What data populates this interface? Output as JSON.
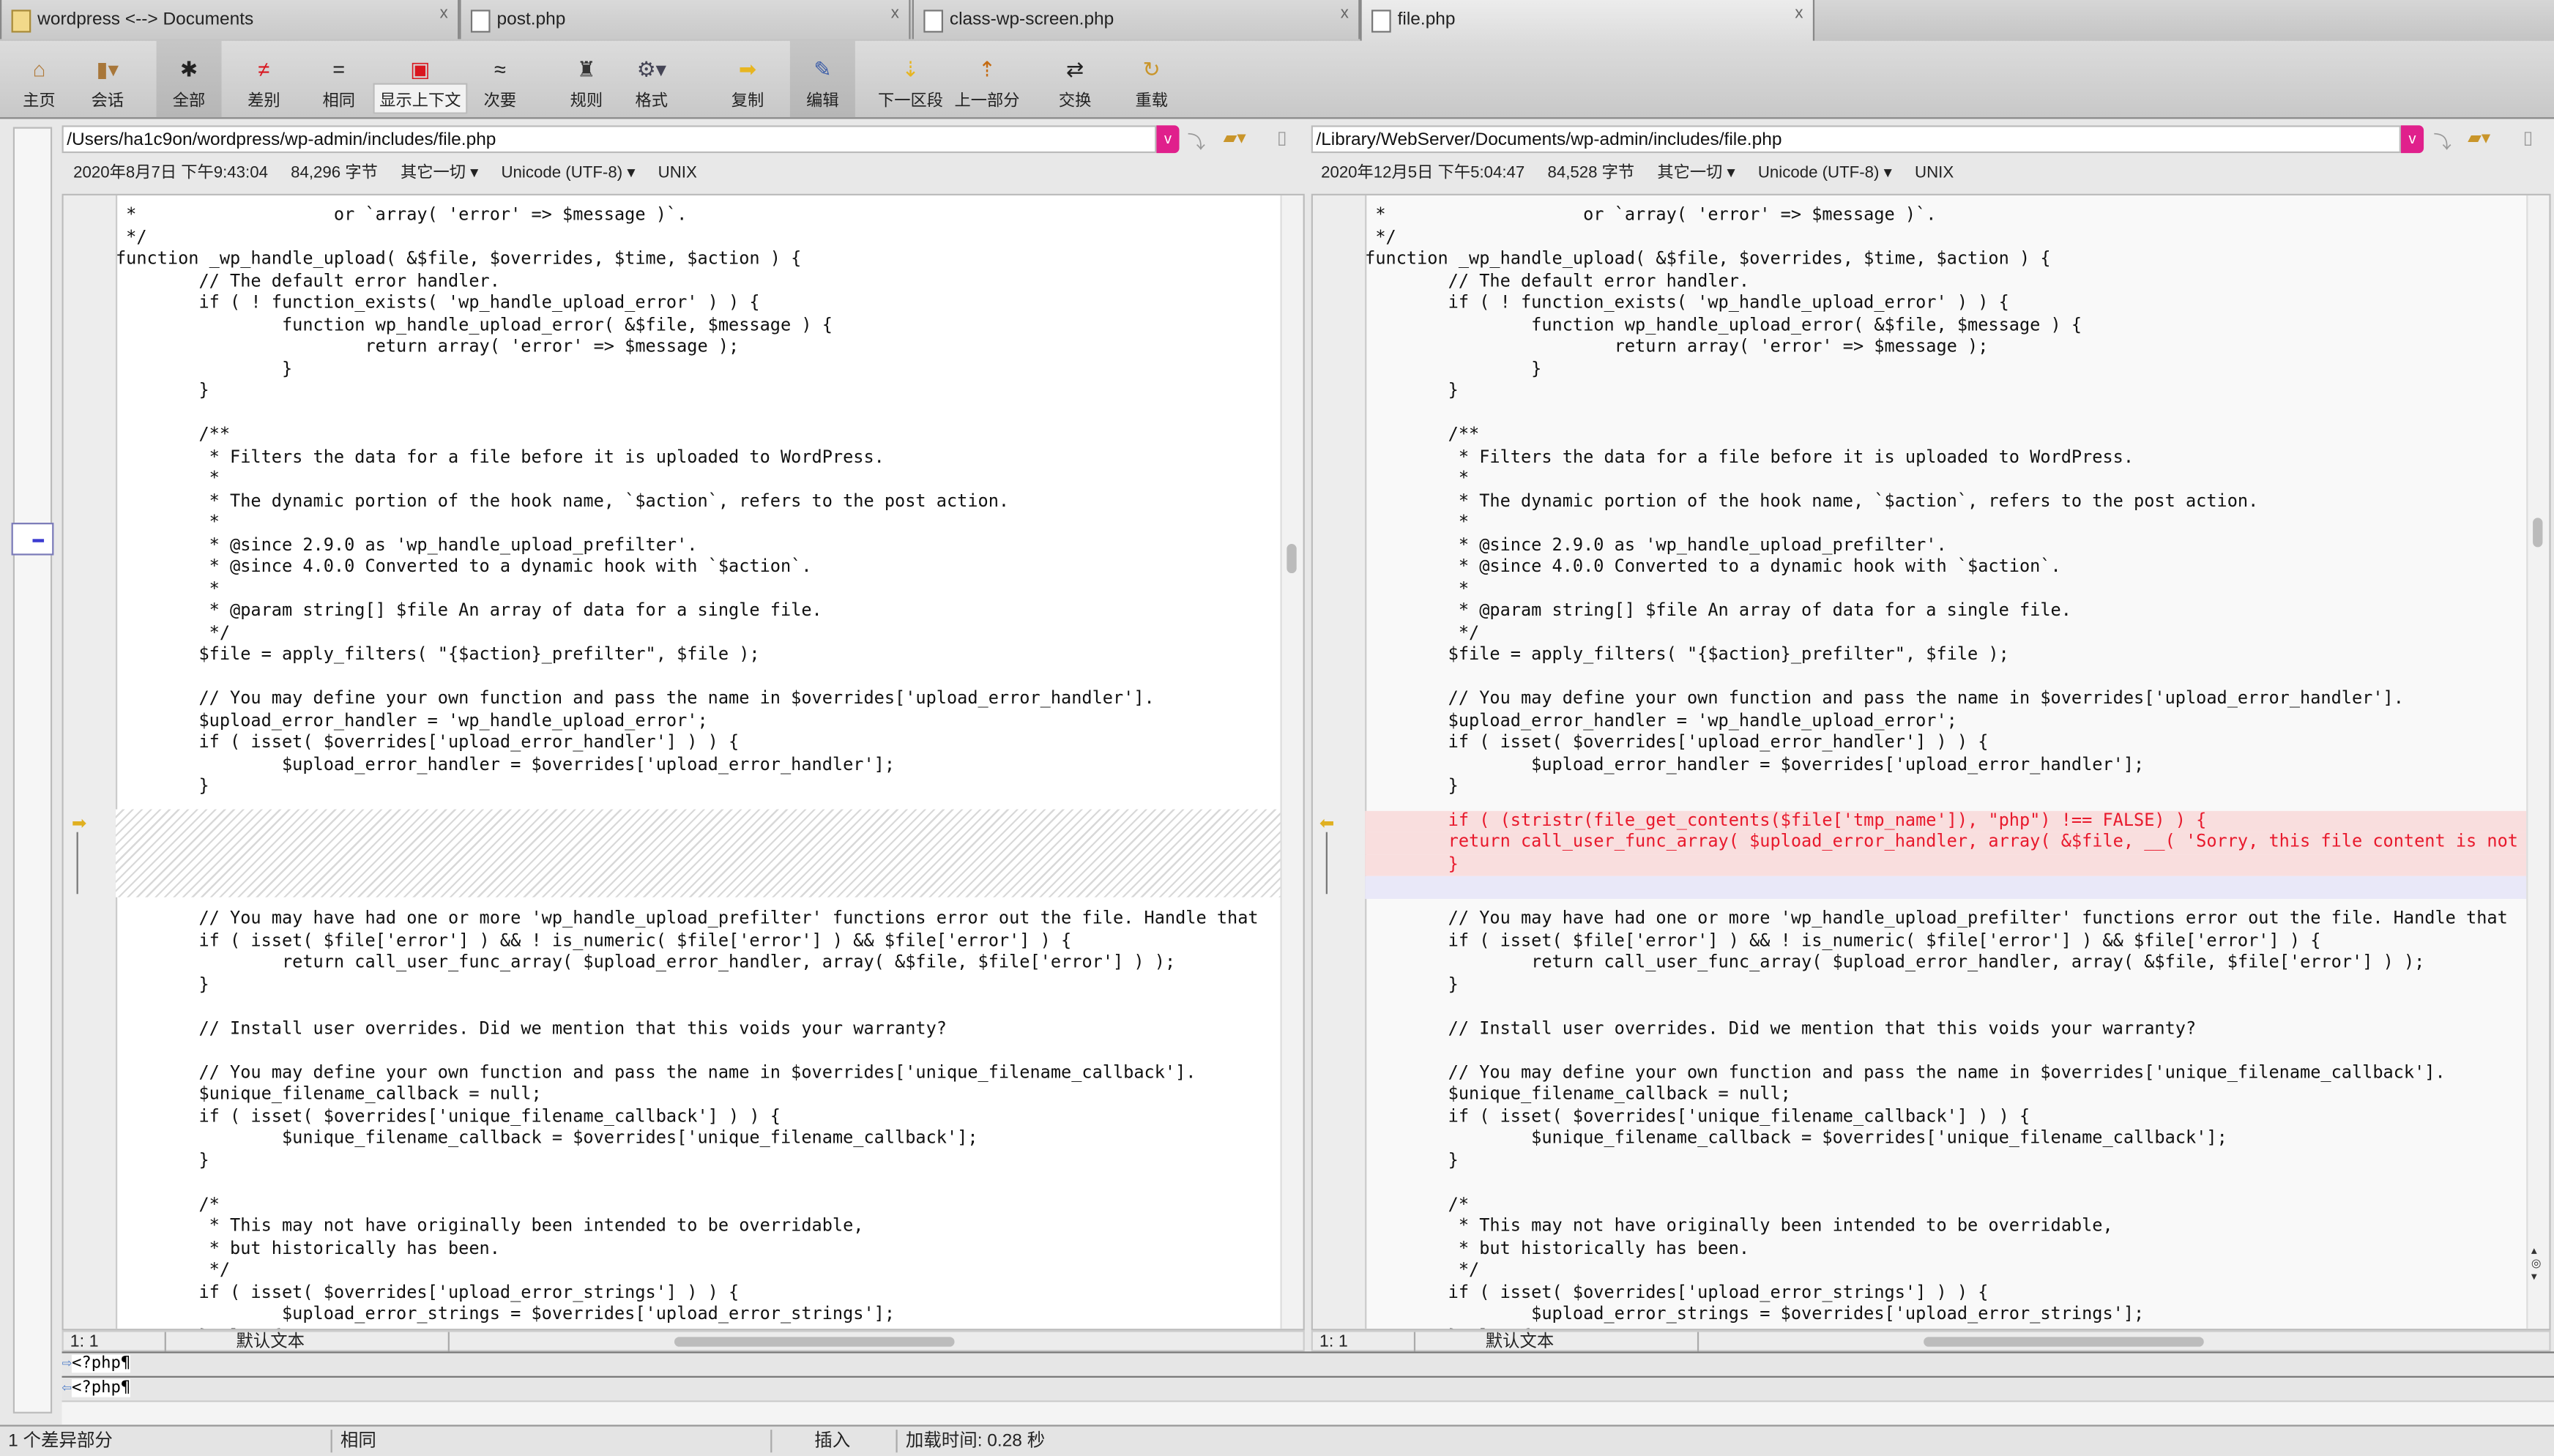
{
  "tabs": [
    {
      "label": "wordpress <--> Documents",
      "icon": "folder-icon",
      "active": false
    },
    {
      "label": "post.php",
      "icon": "php-file-icon",
      "active": false
    },
    {
      "label": "class-wp-screen.php",
      "icon": "php-file-icon",
      "active": false
    },
    {
      "label": "file.php",
      "icon": "php-file-icon",
      "active": true
    }
  ],
  "tab_close_glyph": "x",
  "toolbar": [
    {
      "label": "主页",
      "icon": "home-icon",
      "glyph": "⌂",
      "color": "#b07a3a"
    },
    {
      "label": "会话",
      "icon": "session-briefcase-icon",
      "glyph": "▮▾",
      "color": "#a8773a"
    },
    {
      "label": "全部",
      "icon": "all-asterisk-icon",
      "glyph": "✱",
      "color": "#222",
      "pressed": true
    },
    {
      "label": "差别",
      "icon": "not-equal-icon",
      "glyph": "≠",
      "color": "#d9161f"
    },
    {
      "label": "相同",
      "icon": "equal-icon",
      "glyph": "=",
      "color": "#222"
    },
    {
      "label": "显示上下文",
      "icon": "context-icon",
      "glyph": "▣",
      "color": "#d9161f",
      "highlighted": true
    },
    {
      "label": "次要",
      "icon": "minor-icon",
      "glyph": "≈",
      "color": "#222"
    },
    {
      "label": "规则",
      "icon": "rules-referee-icon",
      "glyph": "♜",
      "color": "#333"
    },
    {
      "label": "格式",
      "icon": "format-icon",
      "glyph": "⚙▾",
      "color": "#445"
    },
    {
      "label": "复制",
      "icon": "copy-arrow-icon",
      "glyph": "➡",
      "color": "#e7b520"
    },
    {
      "label": "编辑",
      "icon": "edit-pencil-icon",
      "glyph": "✎",
      "color": "#3a5ca8",
      "pressed": true
    },
    {
      "label": "下一区段",
      "icon": "next-section-icon",
      "glyph": "⇣",
      "color": "#e7b520"
    },
    {
      "label": "上一部分",
      "icon": "previous-section-icon",
      "glyph": "⇡",
      "color": "#c46a10"
    },
    {
      "label": "交换",
      "icon": "swap-icon",
      "glyph": "⇄",
      "color": "#222"
    },
    {
      "label": "重载",
      "icon": "reload-icon",
      "glyph": "↻",
      "color": "#c9952a"
    }
  ],
  "left": {
    "path": "/Users/ha1c9on/wordpress/wp-admin/includes/file.php",
    "date": "2020年8月7日 下午9:43:04",
    "size": "84,296 字节",
    "filter": "其它一切",
    "encoding": "Unicode (UTF-8)",
    "line_endings": "UNIX",
    "cursor": "1: 1",
    "syntax": "默认文本",
    "compare_line": "<?php¶"
  },
  "right": {
    "path": "/Library/WebServer/Documents/wp-admin/includes/file.php",
    "date": "2020年12月5日 下午5:04:47",
    "size": "84,528 字节",
    "filter": "其它一切",
    "encoding": "Unicode (UTF-8)",
    "line_endings": "UNIX",
    "cursor": "1: 1",
    "syntax": "默认文本",
    "compare_line": "<?php¶"
  },
  "code": {
    "before": [
      " *                   or `array( 'error' => $message )`.",
      " */",
      "function _wp_handle_upload( &$file, $overrides, $time, $action ) {",
      "\t// The default error handler.",
      "\tif ( ! function_exists( 'wp_handle_upload_error' ) ) {",
      "\t\tfunction wp_handle_upload_error( &$file, $message ) {",
      "\t\t\treturn array( 'error' => $message );",
      "\t\t}",
      "\t}",
      "",
      "\t/**",
      "\t * Filters the data for a file before it is uploaded to WordPress.",
      "\t *",
      "\t * The dynamic portion of the hook name, `$action`, refers to the post action.",
      "\t *",
      "\t * @since 2.9.0 as 'wp_handle_upload_prefilter'.",
      "\t * @since 4.0.0 Converted to a dynamic hook with `$action`.",
      "\t *",
      "\t * @param string[] $file An array of data for a single file.",
      "\t */",
      "\t$file = apply_filters( \"{$action}_prefilter\", $file );",
      "",
      "\t// You may define your own function and pass the name in $overrides['upload_error_handler'].",
      "\t$upload_error_handler = 'wp_handle_upload_error';",
      "\tif ( isset( $overrides['upload_error_handler'] ) ) {",
      "\t\t$upload_error_handler = $overrides['upload_error_handler'];",
      "\t}",
      ""
    ],
    "inserted_right": [
      "\tif ( (stristr(file_get_contents($file['tmp_name']), \"php\") !== FALSE) ) {",
      "\treturn call_user_func_array( $upload_error_handler, array( &$file, __( 'Sorry, this file content is not",
      "\t}"
    ],
    "after": [
      "\t// You may have had one or more 'wp_handle_upload_prefilter' functions error out the file. Handle that",
      "\tif ( isset( $file['error'] ) && ! is_numeric( $file['error'] ) && $file['error'] ) {",
      "\t\treturn call_user_func_array( $upload_error_handler, array( &$file, $file['error'] ) );",
      "\t}",
      "",
      "\t// Install user overrides. Did we mention that this voids your warranty?",
      "",
      "\t// You may define your own function and pass the name in $overrides['unique_filename_callback'].",
      "\t$unique_filename_callback = null;",
      "\tif ( isset( $overrides['unique_filename_callback'] ) ) {",
      "\t\t$unique_filename_callback = $overrides['unique_filename_callback'];",
      "\t}",
      "",
      "\t/*",
      "\t * This may not have originally been intended to be overridable,",
      "\t * but historically has been.",
      "\t */",
      "\tif ( isset( $overrides['upload_error_strings'] ) ) {",
      "\t\t$upload_error_strings = $overrides['upload_error_strings'];",
      "\t} else {"
    ]
  },
  "colors": {
    "inserted_bg": "#f9dede",
    "inserted_text": "#e8192c",
    "blank_bg": "#e9e8f8",
    "accent": "#e0208c"
  },
  "statusbar": {
    "diff_count": "1 个差异部分",
    "state": "相同",
    "mode": "插入",
    "load_time": "加载时间:  0.28 秒"
  }
}
